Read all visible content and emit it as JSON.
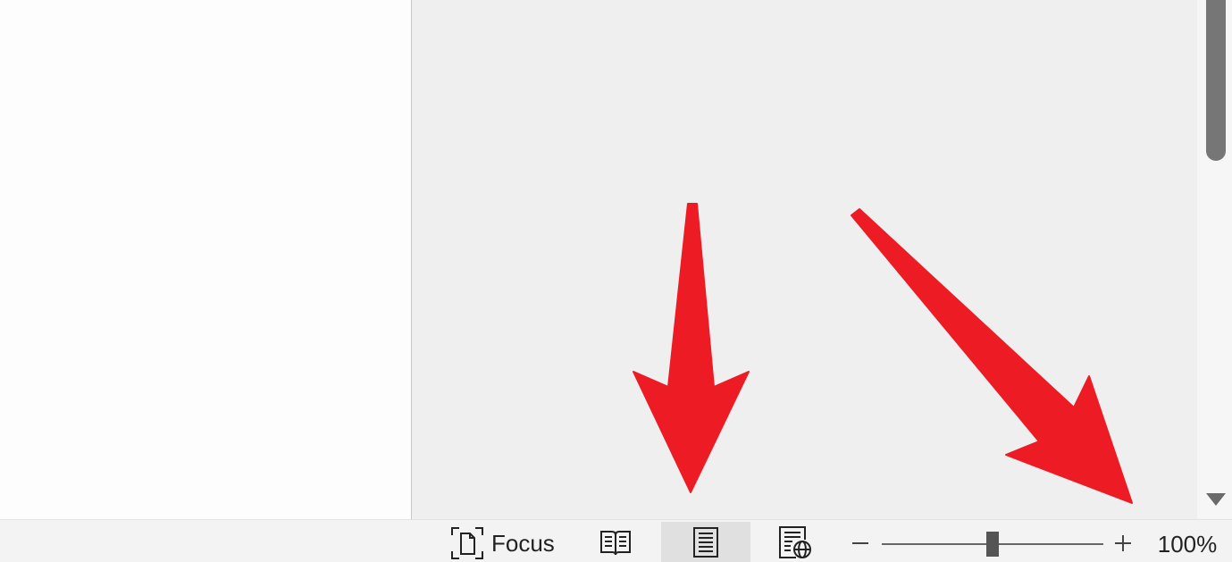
{
  "status_bar": {
    "focus_label": "Focus",
    "views": [
      {
        "name": "read-mode",
        "active": false
      },
      {
        "name": "print-layout",
        "active": true
      },
      {
        "name": "web-layout",
        "active": false
      }
    ],
    "zoom": {
      "minus_label": "−",
      "plus_label": "+",
      "level_text": "100%",
      "level_fraction": 0.5
    }
  },
  "colors": {
    "annotation_arrow": "#ed1c24",
    "canvas": "#efefef",
    "page": "#fdfdfd",
    "status_bar": "#f3f3f3",
    "scroll_thumb": "#767676"
  }
}
